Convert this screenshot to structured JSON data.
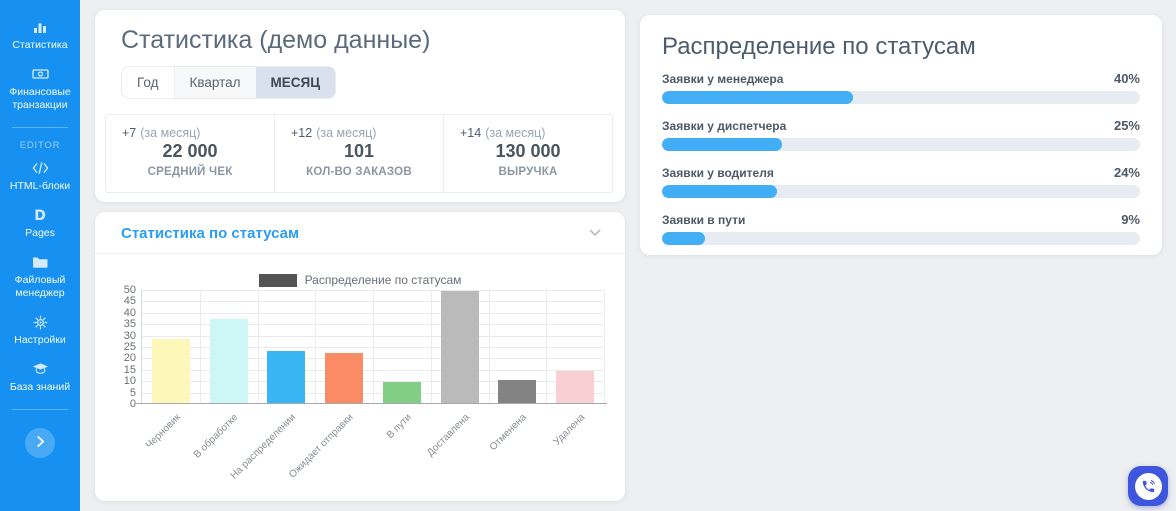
{
  "sidebar": {
    "bg_color": "#1691f2",
    "items": [
      {
        "name": "statistics",
        "label": "Статистика",
        "icon": "chart-bar-icon"
      },
      {
        "name": "financial-transactions",
        "label": "Финансовые транзакции",
        "icon": "banknote-icon"
      },
      {
        "type": "divider"
      },
      {
        "type": "section",
        "label": "EDITOR"
      },
      {
        "name": "html-blocks",
        "label": "HTML-блоки",
        "icon": "code-icon"
      },
      {
        "name": "pages",
        "label": "Pages",
        "icon": "pages-icon"
      },
      {
        "name": "file-manager",
        "label": "Файловый менеджер",
        "icon": "folder-icon"
      },
      {
        "name": "settings",
        "label": "Настройки",
        "icon": "gear-icon"
      },
      {
        "name": "knowledge-base",
        "label": "База знаний",
        "icon": "graduation-cap-icon"
      },
      {
        "type": "divider"
      },
      {
        "type": "expand",
        "icon": "chevron-right-icon"
      }
    ]
  },
  "stats_card": {
    "title": "Статистика (демо данные)",
    "tabs": [
      {
        "name": "year",
        "label": "Год",
        "active": false
      },
      {
        "name": "quarter",
        "label": "Квартал",
        "active": false
      },
      {
        "name": "month",
        "label": "МЕСЯЦ",
        "active": true
      }
    ],
    "metrics": [
      {
        "name": "average-check",
        "delta": "+7",
        "period": "(за месяц)",
        "value": "22 000",
        "caption": "СРЕДНИЙ ЧЕК"
      },
      {
        "name": "orders-count",
        "delta": "+12",
        "period": "(за месяц)",
        "value": "101",
        "caption": "КОЛ-ВО ЗАКАЗОВ"
      },
      {
        "name": "revenue",
        "delta": "+14",
        "period": "(за месяц)",
        "value": "130 000",
        "caption": "ВЫРУЧКА"
      }
    ]
  },
  "chart_card": {
    "header": "Статистика по статусам",
    "collapse_icon": "chevron-down-icon"
  },
  "chart_data": {
    "type": "bar",
    "title": "",
    "legend_label": "Распределение по статусам",
    "legend_color": "#545454",
    "legend_position": "top-center",
    "categories": [
      "Черновик",
      "В обработке",
      "На распределении",
      "Ожидает отправки",
      "В пути",
      "Доставлена",
      "Отменена",
      "Удалена"
    ],
    "values": [
      28,
      37,
      23,
      22,
      9,
      49,
      10,
      14
    ],
    "bar_colors": [
      "#fdf7ba",
      "#cdf7f6",
      "#3ab5f3",
      "#fb8b64",
      "#81cf85",
      "#bababa",
      "#838383",
      "#f9cfd3"
    ],
    "xlabel": "",
    "ylabel": "",
    "ylim": [
      0,
      50
    ],
    "ytick_step": 5,
    "grid": true
  },
  "status_panel": {
    "title": "Распределение по статусам",
    "bar_color": "#41aef5",
    "track_color": "#e7ecf3",
    "rows": [
      {
        "name": "manager",
        "label": "Заявки у менеджера",
        "percent": 40,
        "percent_label": "40%"
      },
      {
        "name": "dispatcher",
        "label": "Заявки у диспетчера",
        "percent": 25,
        "percent_label": "25%"
      },
      {
        "name": "driver",
        "label": "Заявки у водителя",
        "percent": 24,
        "percent_label": "24%"
      },
      {
        "name": "in-transit",
        "label": "Заявки в пути",
        "percent": 9,
        "percent_label": "9%"
      }
    ]
  },
  "floating_button": {
    "icon": "phone-chat-icon",
    "color": "#3e55dd"
  }
}
